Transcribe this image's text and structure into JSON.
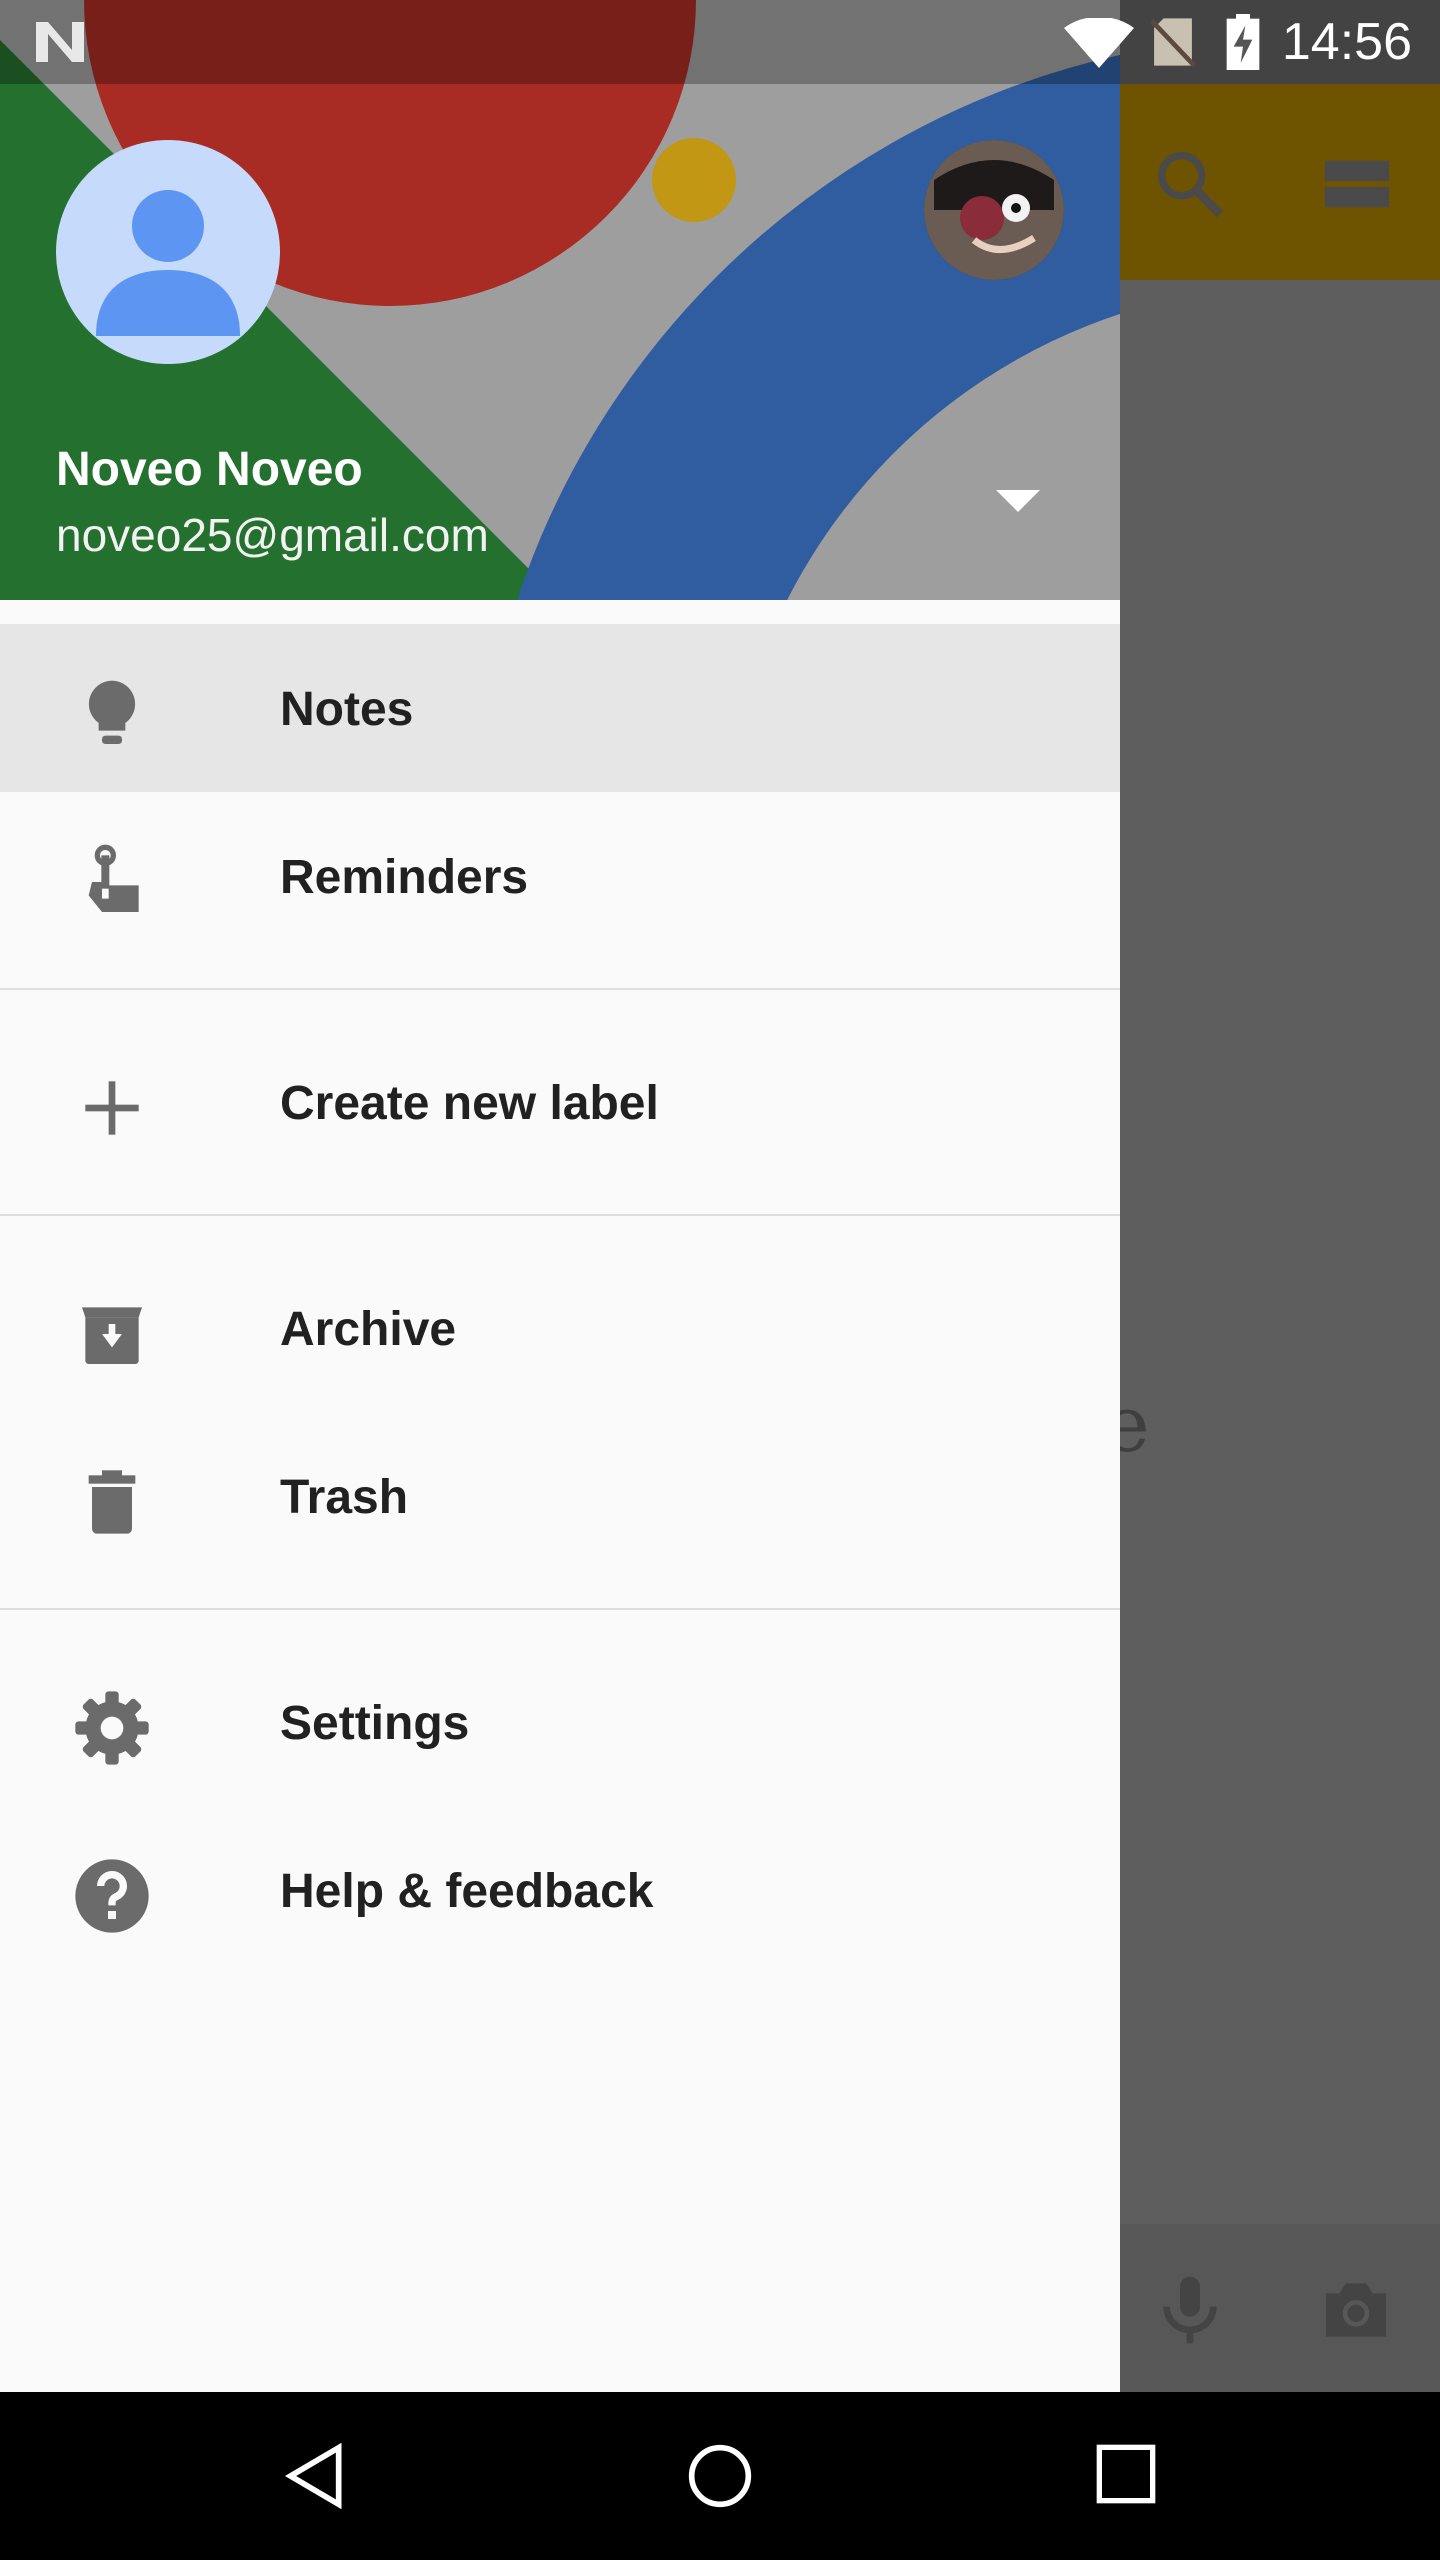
{
  "status_bar": {
    "time": "14:56",
    "icons": [
      "notification-n-icon",
      "wifi-icon",
      "no-sim-icon",
      "battery-charging-icon"
    ]
  },
  "background_app": {
    "partial_text": "ere",
    "toolbar_icons": [
      "search-icon",
      "view-toggle-icon"
    ],
    "bottom_icons": [
      "mic-icon",
      "camera-icon"
    ]
  },
  "drawer": {
    "account": {
      "name": "Noveo Noveo",
      "email": "noveo25@gmail.com"
    },
    "menu": [
      {
        "label": "Notes",
        "icon": "lightbulb-icon",
        "active": true
      },
      {
        "label": "Reminders",
        "icon": "reminder-finger-icon"
      },
      {
        "label": "Create new label",
        "icon": "plus-icon"
      },
      {
        "label": "Archive",
        "icon": "archive-icon"
      },
      {
        "label": "Trash",
        "icon": "trash-icon"
      },
      {
        "label": "Settings",
        "icon": "gear-icon"
      },
      {
        "label": "Help & feedback",
        "icon": "help-icon"
      }
    ]
  },
  "colors": {
    "drawer_bg": "#fafafa",
    "active_item_bg": "#e6e6e6",
    "icon_gray": "#6b6b6b",
    "scrim_toolbar": "#6e5300"
  },
  "nav_bar": {
    "buttons": [
      "back-icon",
      "home-icon",
      "recents-icon"
    ]
  }
}
